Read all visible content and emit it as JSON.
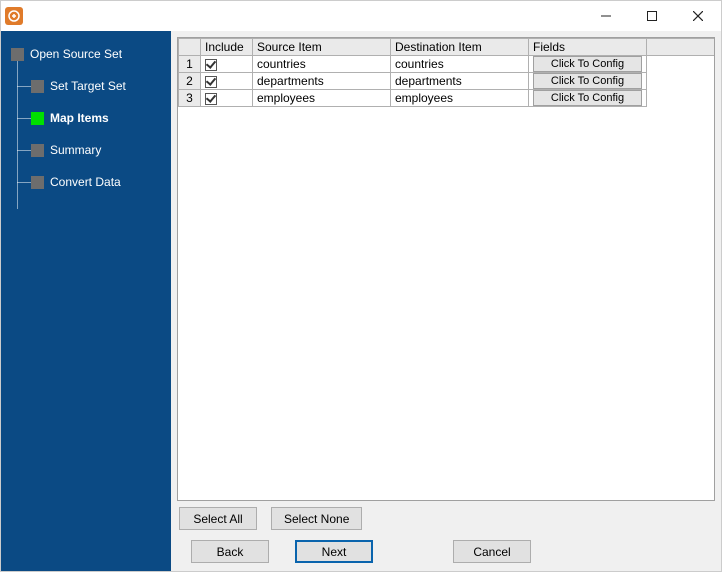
{
  "titlebar": {
    "app_glyph": "⎘"
  },
  "sidebar": {
    "root": "Open Source Set",
    "items": [
      {
        "label": "Set Target Set",
        "active": false
      },
      {
        "label": "Map Items",
        "active": true
      },
      {
        "label": "Summary",
        "active": false
      },
      {
        "label": "Convert Data",
        "active": false
      }
    ]
  },
  "grid": {
    "headers": {
      "row": "",
      "include": "Include",
      "source": "Source Item",
      "destination": "Destination Item",
      "fields": "Fields"
    },
    "config_label": "Click To Config",
    "rows": [
      {
        "num": "1",
        "include": true,
        "source": "countries",
        "destination": "countries"
      },
      {
        "num": "2",
        "include": true,
        "source": "departments",
        "destination": "departments"
      },
      {
        "num": "3",
        "include": true,
        "source": "employees",
        "destination": "employees"
      }
    ]
  },
  "buttons": {
    "select_all": "Select All",
    "select_none": "Select None",
    "back": "Back",
    "next": "Next",
    "cancel": "Cancel"
  }
}
